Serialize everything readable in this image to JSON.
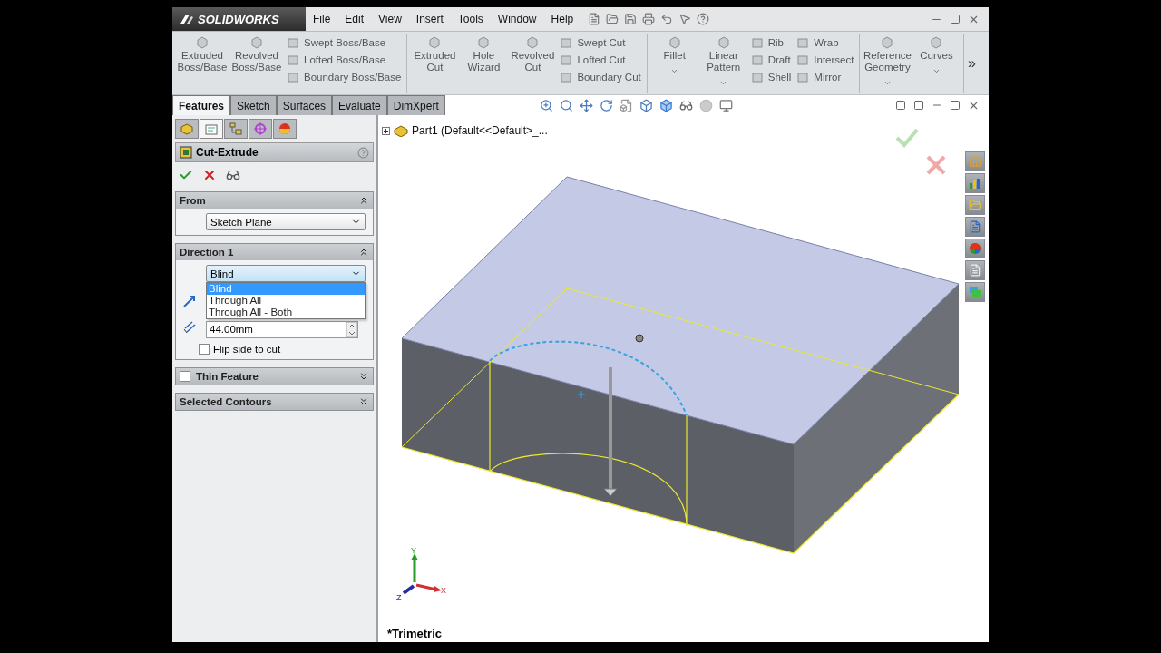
{
  "title_bar": {
    "logo": "SOLIDWORKS",
    "menu": [
      "File",
      "Edit",
      "View",
      "Insert",
      "Tools",
      "Window",
      "Help"
    ]
  },
  "ribbon": {
    "groups": [
      {
        "large": [
          {
            "label": "Extruded Boss/Base",
            "dropdown": false
          },
          {
            "label": "Revolved Boss/Base",
            "dropdown": false
          }
        ],
        "columns": [
          [
            "Swept Boss/Base",
            "Lofted Boss/Base",
            "Boundary Boss/Base"
          ]
        ]
      },
      {
        "large": [
          {
            "label": "Extruded Cut",
            "dropdown": false
          },
          {
            "label": "Hole Wizard",
            "dropdown": false
          },
          {
            "label": "Revolved Cut",
            "dropdown": false
          }
        ],
        "columns": [
          [
            "Swept Cut",
            "Lofted Cut",
            "Boundary Cut"
          ]
        ]
      },
      {
        "large": [
          {
            "label": "Fillet",
            "dropdown": true
          },
          {
            "label": "Linear Pattern",
            "dropdown": true
          }
        ],
        "columns": [
          [
            "Rib",
            "Draft",
            "Shell"
          ],
          [
            "Wrap",
            "Intersect",
            "Mirror"
          ]
        ]
      },
      {
        "large": [
          {
            "label": "Reference Geometry",
            "dropdown": true
          },
          {
            "label": "Curves",
            "dropdown": true
          }
        ]
      }
    ],
    "more": "»"
  },
  "tabs": [
    {
      "label": "Features",
      "selected": true
    },
    {
      "label": "Sketch",
      "selected": false
    },
    {
      "label": "Surfaces",
      "selected": false
    },
    {
      "label": "Evaluate",
      "selected": false
    },
    {
      "label": "DimXpert",
      "selected": false
    }
  ],
  "panel_tabs": [
    {
      "selected": false
    },
    {
      "selected": true
    },
    {
      "selected": false
    },
    {
      "selected": false
    },
    {
      "selected": false
    }
  ],
  "property_manager": {
    "title": "Cut-Extrude",
    "sections": [
      {
        "kind": "from",
        "title": "From",
        "expanded": true,
        "select": {
          "value": "Sketch Plane"
        }
      },
      {
        "kind": "direction",
        "title": "Direction 1",
        "expanded": true,
        "select": {
          "value": "Blind",
          "open": true,
          "options": [
            {
              "label": "Blind",
              "selected": true
            },
            {
              "label": "Through All",
              "selected": false
            },
            {
              "label": "Through All - Both",
              "selected": false
            }
          ]
        },
        "depth": "44.00mm",
        "flip": {
          "label": "Flip side to cut",
          "checked": false
        }
      },
      {
        "kind": "thin",
        "title": "Thin Feature",
        "expanded": false,
        "checked": false
      },
      {
        "kind": "contours",
        "title": "Selected Contours",
        "expanded": false
      }
    ]
  },
  "graphics": {
    "tree_root": "Part1  (Default<<Default>_...",
    "triad": {
      "x": "X",
      "y": "Y",
      "z": "Z"
    },
    "view_name": "*Trimetric"
  }
}
